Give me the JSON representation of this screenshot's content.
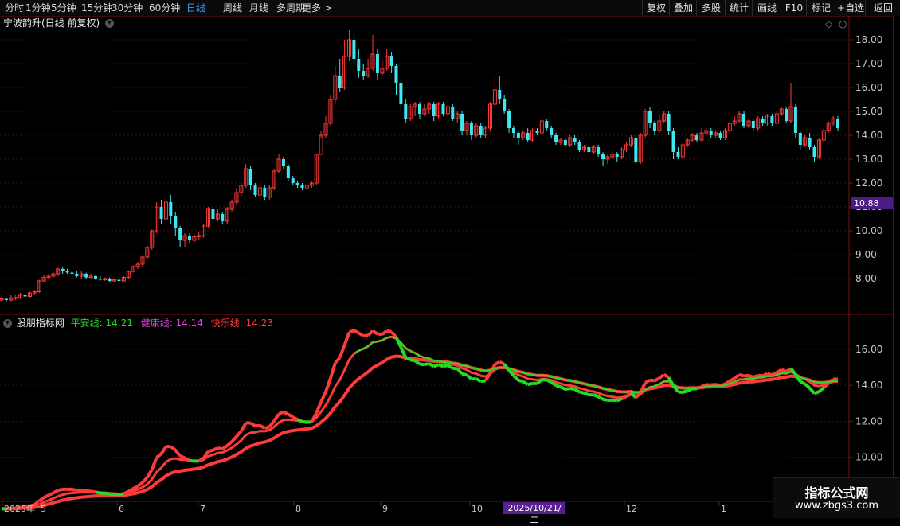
{
  "toolbar": {
    "periods": [
      "分时",
      "1分钟",
      "5分钟",
      "15分钟",
      "30分钟",
      "60分钟",
      "日线",
      "周线",
      "月线",
      "多周期",
      "更多 >"
    ],
    "active_period": "日线",
    "tools": [
      "复权",
      "叠加",
      "多股",
      "统计",
      "画线",
      "F10",
      "标记",
      "+自选",
      "返回"
    ]
  },
  "stock": {
    "title": "宁波韵升(日线 前复权)"
  },
  "indicator": {
    "name": "股朋指标网",
    "lines": [
      {
        "label": "平安线: 14.21",
        "color": "#22dd22"
      },
      {
        "label": "健康线: 14.14",
        "color": "#e040e0"
      },
      {
        "label": "快乐线: 14.23",
        "color": "#ff3a3a"
      }
    ]
  },
  "price_axis": [
    "18.00",
    "17.00",
    "16.00",
    "15.00",
    "14.00",
    "13.00",
    "12.00",
    "11.00",
    "10.00",
    "9.00",
    "8.00"
  ],
  "price_badge": "10.88",
  "indicator_axis": [
    "16.00",
    "14.00",
    "12.00",
    "10.00"
  ],
  "date_axis": [
    "2025年",
    "5",
    "6",
    "7",
    "8",
    "9",
    "10",
    "12",
    "1"
  ],
  "date_badge": "2025/10/21/二",
  "watermark": {
    "title": "指标公式网",
    "url": "www.zbgs3.com"
  },
  "colors": {
    "up": "#ff3a3a",
    "down": "#3fe8f0",
    "green": "#22dd22",
    "bg": "#000000",
    "axis_line": "#7a1010"
  },
  "chart_data": {
    "type": "candlestick",
    "ylim": [
      7.0,
      18.5
    ],
    "indicator_ylim": [
      8.0,
      17.5
    ],
    "candles": [
      [
        7.1,
        7.15,
        7.25,
        7.05
      ],
      [
        7.15,
        7.1,
        7.2,
        7.0
      ],
      [
        7.1,
        7.2,
        7.3,
        7.05
      ],
      [
        7.2,
        7.2,
        7.3,
        7.1
      ],
      [
        7.2,
        7.3,
        7.4,
        7.15
      ],
      [
        7.3,
        7.25,
        7.35,
        7.2
      ],
      [
        7.25,
        7.4,
        7.45,
        7.2
      ],
      [
        7.4,
        7.45,
        7.5,
        7.3
      ],
      [
        7.45,
        7.9,
        7.95,
        7.4
      ],
      [
        7.9,
        8.05,
        8.15,
        7.85
      ],
      [
        8.05,
        8.1,
        8.2,
        8.0
      ],
      [
        8.1,
        8.2,
        8.3,
        8.05
      ],
      [
        8.2,
        8.4,
        8.45,
        8.1
      ],
      [
        8.4,
        8.3,
        8.5,
        8.2
      ],
      [
        8.3,
        8.25,
        8.4,
        8.2
      ],
      [
        8.25,
        8.2,
        8.35,
        8.1
      ],
      [
        8.2,
        8.1,
        8.3,
        8.05
      ],
      [
        8.1,
        8.2,
        8.3,
        8.0
      ],
      [
        8.2,
        8.05,
        8.25,
        8.0
      ],
      [
        8.05,
        8.1,
        8.2,
        8.0
      ],
      [
        8.1,
        8.0,
        8.15,
        7.95
      ],
      [
        8.0,
        7.95,
        8.1,
        7.9
      ],
      [
        7.95,
        8.0,
        8.05,
        7.9
      ],
      [
        8.0,
        7.9,
        8.05,
        7.85
      ],
      [
        7.9,
        7.95,
        8.0,
        7.85
      ],
      [
        7.95,
        7.9,
        8.0,
        7.85
      ],
      [
        7.9,
        8.05,
        8.1,
        7.85
      ],
      [
        8.05,
        8.3,
        8.35,
        8.0
      ],
      [
        8.3,
        8.5,
        8.55,
        8.25
      ],
      [
        8.5,
        8.6,
        8.7,
        8.4
      ],
      [
        8.6,
        8.9,
        8.95,
        8.5
      ],
      [
        8.9,
        9.3,
        9.4,
        8.8
      ],
      [
        9.3,
        10.0,
        10.05,
        9.2
      ],
      [
        10.0,
        11.0,
        11.2,
        9.9
      ],
      [
        11.0,
        10.5,
        11.3,
        10.3
      ],
      [
        10.5,
        11.2,
        12.5,
        10.4
      ],
      [
        11.2,
        10.6,
        11.5,
        10.3
      ],
      [
        10.6,
        10.1,
        10.8,
        9.8
      ],
      [
        10.1,
        9.6,
        10.2,
        9.3
      ],
      [
        9.6,
        9.8,
        9.9,
        9.3
      ],
      [
        9.8,
        9.6,
        9.9,
        9.5
      ],
      [
        9.6,
        9.75,
        9.85,
        9.5
      ],
      [
        9.75,
        9.8,
        9.95,
        9.6
      ],
      [
        9.8,
        10.2,
        10.3,
        9.7
      ],
      [
        10.2,
        10.9,
        11.0,
        10.1
      ],
      [
        10.9,
        10.5,
        11.0,
        10.3
      ],
      [
        10.5,
        10.7,
        10.9,
        10.4
      ],
      [
        10.7,
        10.4,
        10.8,
        10.3
      ],
      [
        10.4,
        10.9,
        11.0,
        10.3
      ],
      [
        10.9,
        11.2,
        11.3,
        10.8
      ],
      [
        11.2,
        11.6,
        11.8,
        11.1
      ],
      [
        11.6,
        11.9,
        12.0,
        11.4
      ],
      [
        11.9,
        12.6,
        12.8,
        11.8
      ],
      [
        12.6,
        11.9,
        12.7,
        11.7
      ],
      [
        11.9,
        11.5,
        12.0,
        11.4
      ],
      [
        11.5,
        11.8,
        11.9,
        11.4
      ],
      [
        11.8,
        11.4,
        11.9,
        11.3
      ],
      [
        11.4,
        11.8,
        11.9,
        11.3
      ],
      [
        11.8,
        12.5,
        12.6,
        11.7
      ],
      [
        12.5,
        13.0,
        13.2,
        12.4
      ],
      [
        13.0,
        12.7,
        13.1,
        12.6
      ],
      [
        12.7,
        12.2,
        12.8,
        12.1
      ],
      [
        12.2,
        12.0,
        12.3,
        11.9
      ],
      [
        12.0,
        11.9,
        12.1,
        11.8
      ],
      [
        11.9,
        11.8,
        12.0,
        11.7
      ],
      [
        11.8,
        11.9,
        12.0,
        11.7
      ],
      [
        11.9,
        12.0,
        12.1,
        11.8
      ],
      [
        12.0,
        13.2,
        13.2,
        11.9
      ],
      [
        13.2,
        14.0,
        14.2,
        13.9
      ],
      [
        14.0,
        14.5,
        14.8,
        13.9
      ],
      [
        14.5,
        15.5,
        15.7,
        14.4
      ],
      [
        15.5,
        16.5,
        16.9,
        15.3
      ],
      [
        16.5,
        16.0,
        17.2,
        15.8
      ],
      [
        16.0,
        17.3,
        18.0,
        15.9
      ],
      [
        17.3,
        18.0,
        18.4,
        17.1
      ],
      [
        18.0,
        17.2,
        18.3,
        16.6
      ],
      [
        17.2,
        16.7,
        17.6,
        16.4
      ],
      [
        16.7,
        16.5,
        17.0,
        16.3
      ],
      [
        16.5,
        16.8,
        17.2,
        16.4
      ],
      [
        16.8,
        17.4,
        18.2,
        16.7
      ],
      [
        17.4,
        16.6,
        17.6,
        16.3
      ],
      [
        16.6,
        16.8,
        17.2,
        16.5
      ],
      [
        16.8,
        17.3,
        17.6,
        16.7
      ],
      [
        17.3,
        16.9,
        17.5,
        16.6
      ],
      [
        16.9,
        16.2,
        17.0,
        15.7
      ],
      [
        16.2,
        15.3,
        16.3,
        15.0
      ],
      [
        15.3,
        14.7,
        15.5,
        14.5
      ],
      [
        14.7,
        15.2,
        15.3,
        14.6
      ],
      [
        15.2,
        15.3,
        15.4,
        14.8
      ],
      [
        15.3,
        14.9,
        15.4,
        14.7
      ],
      [
        14.9,
        15.1,
        15.3,
        14.8
      ],
      [
        15.1,
        15.3,
        15.4,
        14.9
      ],
      [
        15.3,
        14.8,
        15.4,
        14.6
      ],
      [
        14.8,
        15.3,
        15.4,
        14.7
      ],
      [
        15.3,
        14.9,
        15.4,
        14.8
      ],
      [
        14.9,
        15.2,
        15.3,
        14.8
      ],
      [
        15.2,
        14.7,
        15.3,
        14.6
      ],
      [
        14.7,
        14.9,
        15.0,
        14.5
      ],
      [
        14.9,
        14.2,
        15.0,
        14.0
      ],
      [
        14.2,
        14.5,
        14.6,
        14.0
      ],
      [
        14.5,
        14.0,
        14.6,
        13.8
      ],
      [
        14.0,
        14.4,
        14.5,
        13.9
      ],
      [
        14.4,
        14.0,
        14.5,
        13.9
      ],
      [
        14.0,
        14.3,
        14.4,
        13.9
      ],
      [
        14.3,
        15.3,
        15.4,
        14.2
      ],
      [
        15.3,
        15.9,
        16.5,
        15.2
      ],
      [
        15.9,
        15.5,
        16.5,
        15.3
      ],
      [
        15.5,
        15.0,
        15.7,
        14.9
      ],
      [
        15.0,
        14.3,
        15.1,
        14.1
      ],
      [
        14.3,
        14.1,
        14.4,
        13.9
      ],
      [
        14.1,
        13.9,
        14.2,
        13.6
      ],
      [
        13.9,
        14.1,
        14.2,
        13.8
      ],
      [
        14.1,
        13.8,
        14.3,
        13.7
      ],
      [
        13.8,
        14.2,
        14.3,
        13.7
      ],
      [
        14.2,
        14.1,
        14.3,
        14.0
      ],
      [
        14.1,
        14.6,
        14.7,
        14.0
      ],
      [
        14.6,
        14.3,
        14.7,
        14.2
      ],
      [
        14.3,
        14.0,
        14.4,
        13.9
      ],
      [
        14.0,
        13.7,
        14.1,
        13.6
      ],
      [
        13.7,
        13.8,
        13.9,
        13.6
      ],
      [
        13.8,
        13.6,
        13.9,
        13.5
      ],
      [
        13.6,
        13.9,
        14.0,
        13.5
      ],
      [
        13.9,
        13.7,
        14.0,
        13.6
      ],
      [
        13.7,
        13.4,
        13.8,
        13.3
      ],
      [
        13.4,
        13.5,
        13.6,
        13.3
      ],
      [
        13.5,
        13.3,
        13.6,
        13.2
      ],
      [
        13.3,
        13.5,
        13.6,
        13.2
      ],
      [
        13.5,
        13.2,
        13.6,
        13.1
      ],
      [
        13.2,
        13.0,
        13.3,
        12.7
      ],
      [
        13.0,
        13.1,
        13.2,
        12.8
      ],
      [
        13.1,
        13.2,
        13.3,
        13.0
      ],
      [
        13.2,
        13.1,
        13.3,
        12.9
      ],
      [
        13.1,
        13.4,
        13.5,
        13.0
      ],
      [
        13.4,
        13.6,
        13.7,
        13.3
      ],
      [
        13.6,
        13.9,
        14.0,
        13.5
      ],
      [
        13.9,
        12.9,
        14.0,
        12.8
      ],
      [
        12.9,
        14.0,
        14.1,
        12.8
      ],
      [
        14.0,
        15.0,
        15.1,
        13.9
      ],
      [
        15.0,
        14.5,
        15.2,
        14.3
      ],
      [
        14.5,
        14.2,
        14.6,
        14.0
      ],
      [
        14.2,
        14.6,
        14.9,
        14.1
      ],
      [
        14.6,
        14.9,
        15.0,
        14.5
      ],
      [
        14.9,
        14.2,
        15.0,
        14.0
      ],
      [
        14.2,
        13.3,
        14.3,
        13.0
      ],
      [
        13.3,
        13.1,
        13.5,
        13.0
      ],
      [
        13.1,
        13.6,
        13.7,
        13.0
      ],
      [
        13.6,
        13.8,
        13.9,
        13.5
      ],
      [
        13.8,
        14.0,
        14.1,
        13.7
      ],
      [
        14.0,
        13.8,
        14.1,
        13.7
      ],
      [
        13.8,
        14.1,
        14.3,
        13.7
      ],
      [
        14.1,
        14.2,
        14.3,
        14.0
      ],
      [
        14.2,
        14.0,
        14.3,
        13.9
      ],
      [
        14.0,
        14.1,
        14.2,
        13.9
      ],
      [
        14.1,
        13.9,
        14.2,
        13.8
      ],
      [
        13.9,
        14.2,
        14.3,
        13.8
      ],
      [
        14.2,
        14.5,
        14.6,
        14.1
      ],
      [
        14.5,
        14.6,
        14.8,
        14.4
      ],
      [
        14.6,
        14.9,
        15.0,
        14.5
      ],
      [
        14.9,
        14.4,
        15.0,
        14.3
      ],
      [
        14.4,
        14.6,
        14.7,
        14.3
      ],
      [
        14.6,
        14.3,
        14.7,
        14.2
      ],
      [
        14.3,
        14.7,
        14.8,
        14.2
      ],
      [
        14.7,
        14.5,
        14.8,
        14.4
      ],
      [
        14.5,
        14.8,
        14.9,
        14.4
      ],
      [
        14.8,
        14.5,
        14.9,
        14.4
      ],
      [
        14.5,
        14.9,
        15.0,
        14.4
      ],
      [
        14.9,
        15.1,
        15.2,
        14.8
      ],
      [
        15.1,
        14.6,
        15.2,
        14.5
      ],
      [
        14.6,
        15.2,
        16.2,
        14.5
      ],
      [
        15.2,
        14.1,
        15.3,
        13.9
      ],
      [
        14.1,
        13.6,
        14.2,
        13.4
      ],
      [
        13.6,
        13.9,
        14.0,
        13.5
      ],
      [
        13.9,
        13.5,
        14.1,
        13.4
      ],
      [
        13.5,
        13.1,
        13.6,
        12.9
      ],
      [
        13.1,
        13.8,
        13.9,
        13.0
      ],
      [
        13.8,
        14.2,
        14.3,
        13.7
      ],
      [
        14.2,
        14.5,
        14.6,
        14.1
      ],
      [
        14.5,
        14.7,
        14.8,
        14.4
      ],
      [
        14.7,
        14.3,
        14.8,
        14.2
      ]
    ],
    "lines": [
      {
        "name": "平安线",
        "value": 14.21
      },
      {
        "name": "健康线",
        "value": 14.14
      },
      {
        "name": "快乐线",
        "value": 14.23
      }
    ]
  }
}
